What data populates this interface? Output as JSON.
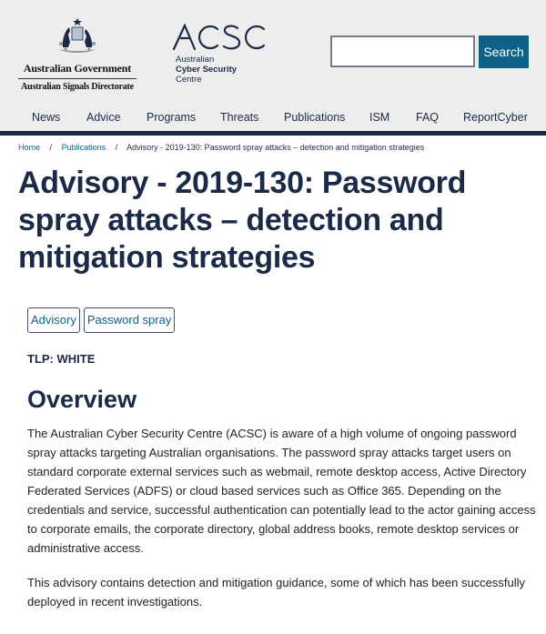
{
  "header": {
    "gov_logo": {
      "icon": "coat-of-arms-icon",
      "line1": "Australian Government",
      "line2": "Australian Signals Directorate"
    },
    "acsc_logo": {
      "wordmark": "ACSC",
      "sub1": "Australian",
      "sub2": "Cyber Security",
      "sub3": "Centre"
    },
    "search": {
      "value": "",
      "placeholder": "",
      "button_label": "Search"
    }
  },
  "nav": {
    "items": [
      {
        "label": "News"
      },
      {
        "label": "Advice"
      },
      {
        "label": "Programs"
      },
      {
        "label": "Threats"
      },
      {
        "label": "Publications"
      },
      {
        "label": "ISM"
      },
      {
        "label": "FAQ"
      },
      {
        "label": "ReportCyber"
      }
    ]
  },
  "breadcrumb": {
    "items": [
      {
        "label": "Home"
      },
      {
        "label": "Publications"
      }
    ],
    "separator": "/",
    "current": "Advisory - 2019-130: Password spray attacks – detection and mitigation strategies"
  },
  "page": {
    "title": "Advisory - 2019-130: Password spray attacks – detection and mitigation strategies",
    "tags": [
      {
        "label": "Advisory"
      },
      {
        "label": "Password spray"
      }
    ],
    "tlp": "TLP: WHITE",
    "overview_heading": "Overview",
    "paragraphs": [
      "The Australian Cyber Security Centre (ACSC) is aware of a high volume of ongoing password spray attacks targeting Australian organisations. The password spray attacks target users on standard corporate external services such as webmail, remote desktop access, Active Directory Federated Services (ADFS) or cloud based services such as Office 365. Depending on the credentials and service, successful authentication can potentially lead to the actor gaining access to corporate emails, the corporate directory, global address books, remote desktop services or administrative access.",
      "This advisory contains detection and mitigation guidance, some of which has been successfully deployed in recent investigations."
    ]
  },
  "colors": {
    "navy": "#1b2a47",
    "link_blue": "#0e6189",
    "header_bg": "#ededed"
  }
}
